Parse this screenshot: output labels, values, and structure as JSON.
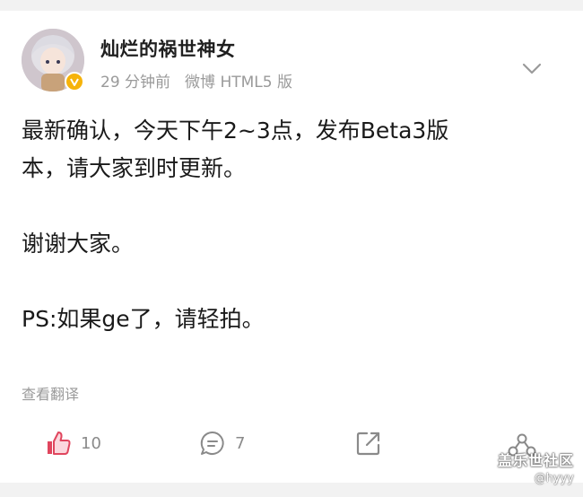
{
  "post": {
    "username": "灿烂的祸世神女",
    "time": "29 分钟前",
    "source": "微博 HTML5 版",
    "content_lines": [
      "最新确认，今天下午2~3点，发布Beta3版",
      "本，请大家到时更新。",
      "谢谢大家。",
      "PS:如果ge了，请轻拍。"
    ],
    "translate_label": "查看翻译"
  },
  "actions": {
    "like_count": "10",
    "comment_count": "7"
  },
  "watermark": {
    "site": "盖乐世社区",
    "handle": "@hyyy"
  },
  "colors": {
    "like_accent": "#e0465e",
    "verified_badge": "#f6b30a",
    "meta_gray": "#9a9a9a",
    "background": "#f2f2f2"
  },
  "icons": {
    "like": "thumbs-up-icon",
    "comment": "comment-bubble-icon",
    "share": "share-arrow-icon",
    "more": "chevron-down-icon",
    "verified": "verified-badge-icon"
  }
}
